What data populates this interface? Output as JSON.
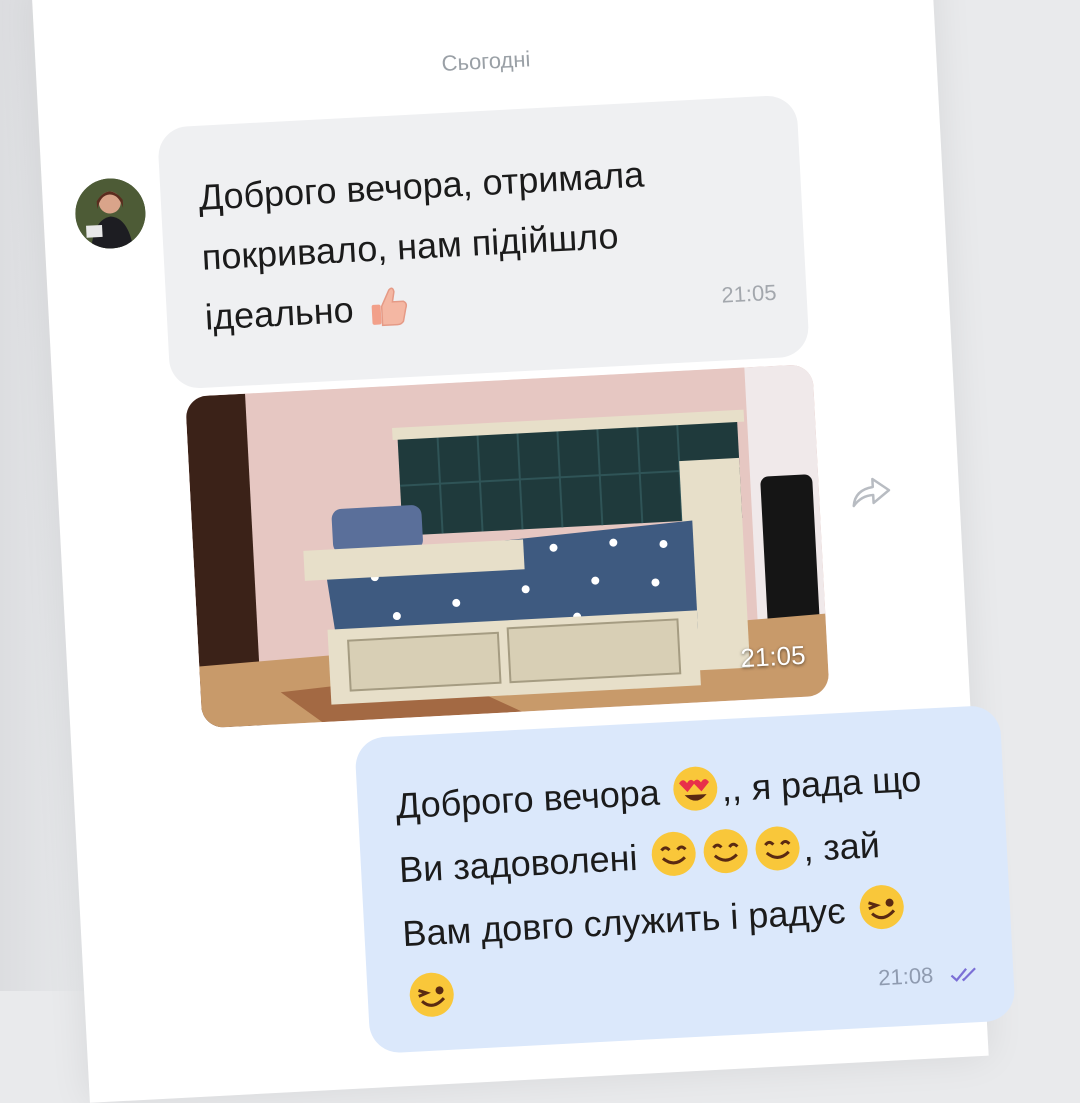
{
  "date_separator": "Сьогодні",
  "incoming": {
    "lines": [
      "Доброго вечора, отримала",
      "покривало, нам підійшло",
      "ідеально"
    ],
    "emoji": "thumbs-up-icon",
    "time": "21:05"
  },
  "photo": {
    "time": "21:05",
    "description_icon": "image-bed-photo"
  },
  "outgoing": {
    "line1_a": "Доброго вечора",
    "line1_b": ",, я рада що",
    "line2_a": "Ви задоволені",
    "line2_b": ", зай",
    "line3": "Вам довго служить і радує",
    "time": "21:08",
    "status": "read-double-check-icon"
  },
  "colors": {
    "incoming_bubble": "#eff0f2",
    "outgoing_bubble": "#dbe8fb",
    "ticks": "#7b6fd6"
  }
}
